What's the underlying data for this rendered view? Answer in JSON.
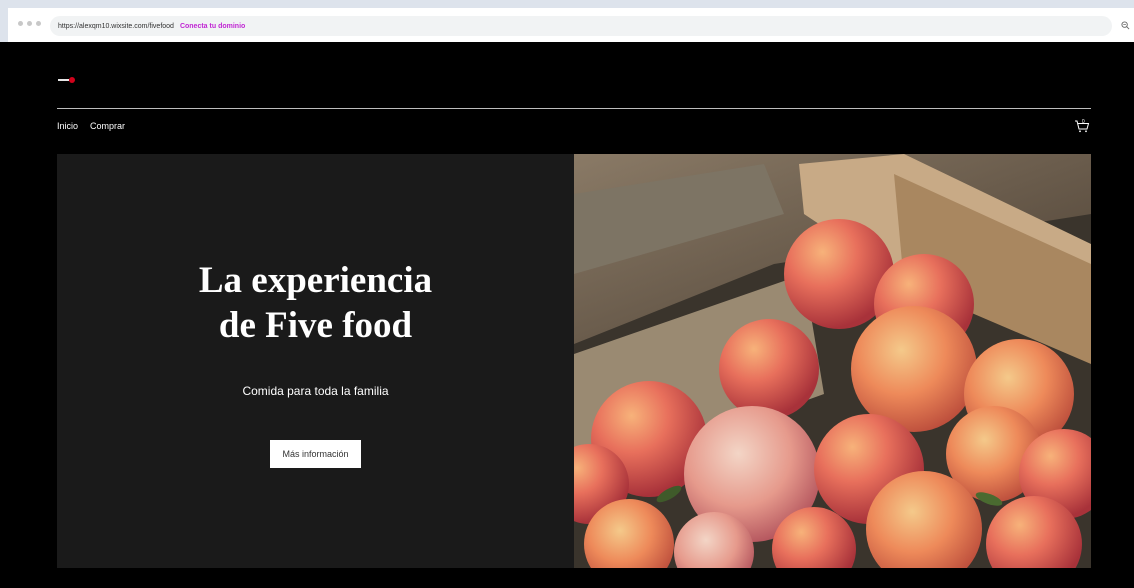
{
  "browser": {
    "url": "https://alexqm10.wixsite.com/fivefood",
    "connect_domain": "Conecta tu dominio",
    "icons": [
      "window-dots-icon",
      "zoom-icon"
    ]
  },
  "header": {
    "nav": [
      "Inicio",
      "Comprar"
    ],
    "cart_count": "0"
  },
  "hero": {
    "title_line1": "La experiencia",
    "title_line2": "de Five food",
    "subtitle": "Comida para toda la familia",
    "button": "Más información",
    "image": "peaches-in-wooden-crate-image"
  },
  "colors": {
    "background": "#000000",
    "hero_panel": "#1a1a1a",
    "connect_link": "#c026d3"
  }
}
